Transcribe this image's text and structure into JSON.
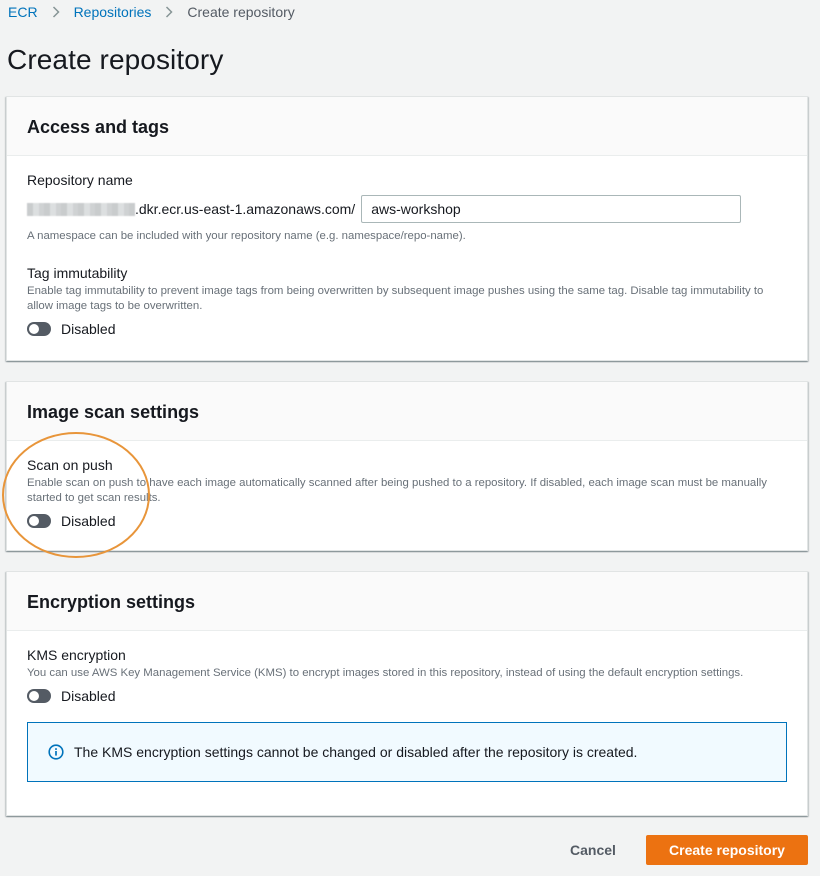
{
  "breadcrumb": {
    "items": [
      "ECR",
      "Repositories"
    ],
    "current": "Create repository"
  },
  "page_title": "Create repository",
  "access_and_tags": {
    "title": "Access and tags",
    "repo_name_label": "Repository name",
    "uri_suffix": ".dkr.ecr.us-east-1.amazonaws.com/",
    "repo_name_value": "aws-workshop",
    "repo_name_hint": "A namespace can be included with your repository name (e.g. namespace/repo-name).",
    "tag_immutability_label": "Tag immutability",
    "tag_immutability_desc": "Enable tag immutability to prevent image tags from being overwritten by subsequent image pushes using the same tag. Disable tag immutability to allow image tags to be overwritten.",
    "tag_immutability_state": "Disabled"
  },
  "image_scan": {
    "title": "Image scan settings",
    "scan_on_push_label": "Scan on push",
    "scan_on_push_desc": "Enable scan on push to have each image automatically scanned after being pushed to a repository. If disabled, each image scan must be manually started to get scan results.",
    "scan_on_push_state": "Disabled"
  },
  "encryption": {
    "title": "Encryption settings",
    "kms_label": "KMS encryption",
    "kms_desc": "You can use AWS Key Management Service (KMS) to encrypt images stored in this repository, instead of using the default encryption settings.",
    "kms_state": "Disabled",
    "alert_text": "The KMS encryption settings cannot be changed or disabled after the repository is created."
  },
  "actions": {
    "cancel": "Cancel",
    "create": "Create repository"
  },
  "colors": {
    "link": "#0073bb",
    "primary_button": "#ec7211",
    "highlight_annotation": "#e8953a",
    "toggle_off": "#545b64",
    "info_border": "#0073bb"
  },
  "icons": {
    "breadcrumb_separator": "chevron-right-icon",
    "alert": "info-icon"
  }
}
